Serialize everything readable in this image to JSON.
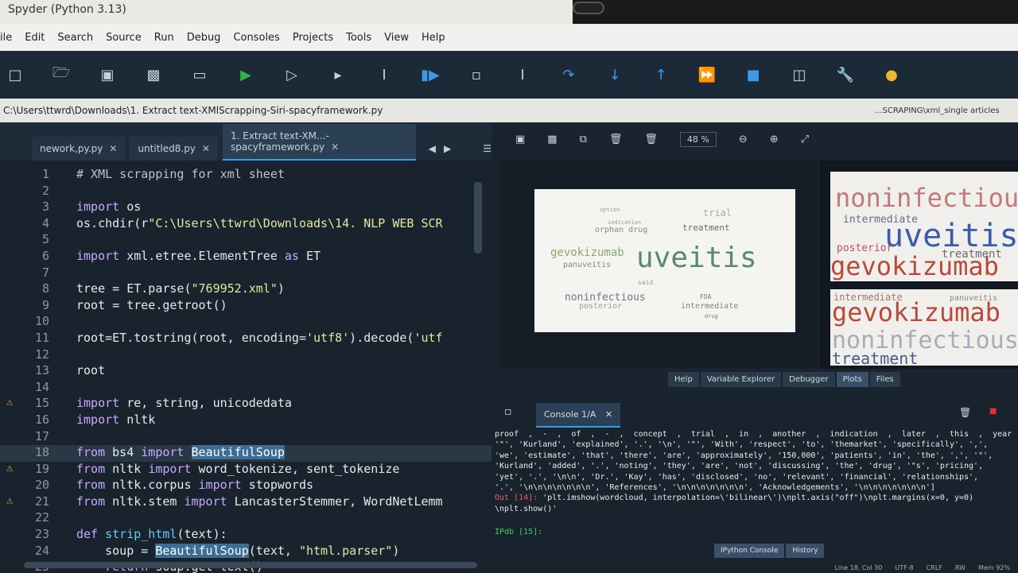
{
  "window": {
    "title": "Spyder (Python 3.13)"
  },
  "menu": [
    "ile",
    "Edit",
    "Search",
    "Source",
    "Run",
    "Debug",
    "Consoles",
    "Projects",
    "Tools",
    "View",
    "Help"
  ],
  "path": "C:\\Users\\ttwrd\\Downloads\\1. Extract text-XMlScrapping-Siri-spacyframework.py",
  "path_crumb": "...SCRAPING\\xml_single articles",
  "editor": {
    "tabs": [
      {
        "label": "nework,py.py",
        "active": false
      },
      {
        "label": "untitled8.py",
        "active": false
      },
      {
        "label": "1. Extract text-XM...-spacyframework.py",
        "active": true
      }
    ],
    "lines": [
      {
        "n": "1",
        "text": "# XML scrapping for xml sheet"
      },
      {
        "n": "2",
        "text": ""
      },
      {
        "n": "3",
        "text": "import os"
      },
      {
        "n": "4",
        "text": "os.chdir(r\"C:\\Users\\ttwrd\\Downloads\\14. NLP WEB SCR"
      },
      {
        "n": "5",
        "text": ""
      },
      {
        "n": "6",
        "text": "import xml.etree.ElementTree as ET"
      },
      {
        "n": "7",
        "text": ""
      },
      {
        "n": "8",
        "text": "tree = ET.parse(\"769952.xml\")"
      },
      {
        "n": "9",
        "text": "root = tree.getroot()"
      },
      {
        "n": "10",
        "text": ""
      },
      {
        "n": "11",
        "text": "root=ET.tostring(root, encoding='utf8').decode('utf"
      },
      {
        "n": "12",
        "text": ""
      },
      {
        "n": "13",
        "text": "root"
      },
      {
        "n": "14",
        "text": ""
      },
      {
        "n": "15",
        "text": "import re, string, unicodedata"
      },
      {
        "n": "16",
        "text": "import nltk"
      },
      {
        "n": "17",
        "text": ""
      },
      {
        "n": "18",
        "text": "from bs4 import BeautifulSoup"
      },
      {
        "n": "19",
        "text": "from nltk import word_tokenize, sent_tokenize"
      },
      {
        "n": "20",
        "text": "from nltk.corpus import stopwords"
      },
      {
        "n": "21",
        "text": "from nltk.stem import LancasterStemmer, WordNetLemm"
      },
      {
        "n": "22",
        "text": ""
      },
      {
        "n": "23",
        "text": "def strip_html(text):"
      },
      {
        "n": "24",
        "text": "    soup = BeautifulSoup(text, \"html.parser\")"
      },
      {
        "n": "25",
        "text": "    return soup.get_text()"
      }
    ]
  },
  "plots": {
    "zoom": "48 %",
    "bottom_tabs": [
      "Help",
      "Variable Explorer",
      "Debugger",
      "Plots",
      "Files"
    ],
    "active_tab": "Plots",
    "wordcloud_words": [
      "uveitis",
      "gevokizumab",
      "noninfectious",
      "treatment",
      "intermediate",
      "orphan drug",
      "posterior",
      "trial",
      "panuveitis",
      "FDA",
      "drug",
      "indication",
      "option",
      "said"
    ],
    "thumb1_words": [
      "noninfectious",
      "uveitis",
      "gevokizumab",
      "intermediate",
      "treatment",
      "posterior"
    ],
    "thumb2_words": [
      "gevokizumab",
      "noninfectious",
      "treatment",
      "intermediate",
      "panuveitis"
    ]
  },
  "console": {
    "tab": "Console 1/A",
    "output_lines": [
      "proof  ,  -  ,  of  ,  -  ,  concept  ,  trial  ,  in  ,  another  ,  indication  ,  later  ,  this  ,  year  ,  ,",
      "'\"', 'Kurland', 'explained', '.', '\\n', '\"', 'With', 'respect', 'to', 'themarket', 'specifically', ',',",
      "'we', 'estimate', 'that', 'there', 'are', 'approximately', '150,000', 'patients', 'in', 'the', ',', '\"',",
      "'Kurland', 'added', '.', 'noting', 'they', 'are', 'not', 'discussing', 'the', 'drug', '\"s', 'pricing',",
      "'yet', '.', '\\n\\n', 'Dr.', 'Kay', 'has', 'disclosed', 'no', 'relevant', 'financial', 'relationships',",
      "'.', '\\n\\n\\n\\n\\n\\n\\n', 'References', '\\n\\n\\n\\n\\n\\n\\n', 'Acknowledgements', '\\n\\n\\n\\n\\n\\n\\n']"
    ],
    "out_label": "Out [14]:",
    "out_text": "'plt.imshow(wordcloud, interpolation=\\'bilinear\\')\\nplt.axis(\"off\")\\nplt.margins(x=0, y=0)",
    "out_text2": "\\nplt.show()'",
    "prompt": "IPdb [15]:",
    "bottom_tabs": [
      "IPython Console",
      "History"
    ]
  },
  "status": [
    "Line 18, Col 30",
    "UTF-8",
    "CRLF",
    "RW",
    "Mem 92%"
  ]
}
